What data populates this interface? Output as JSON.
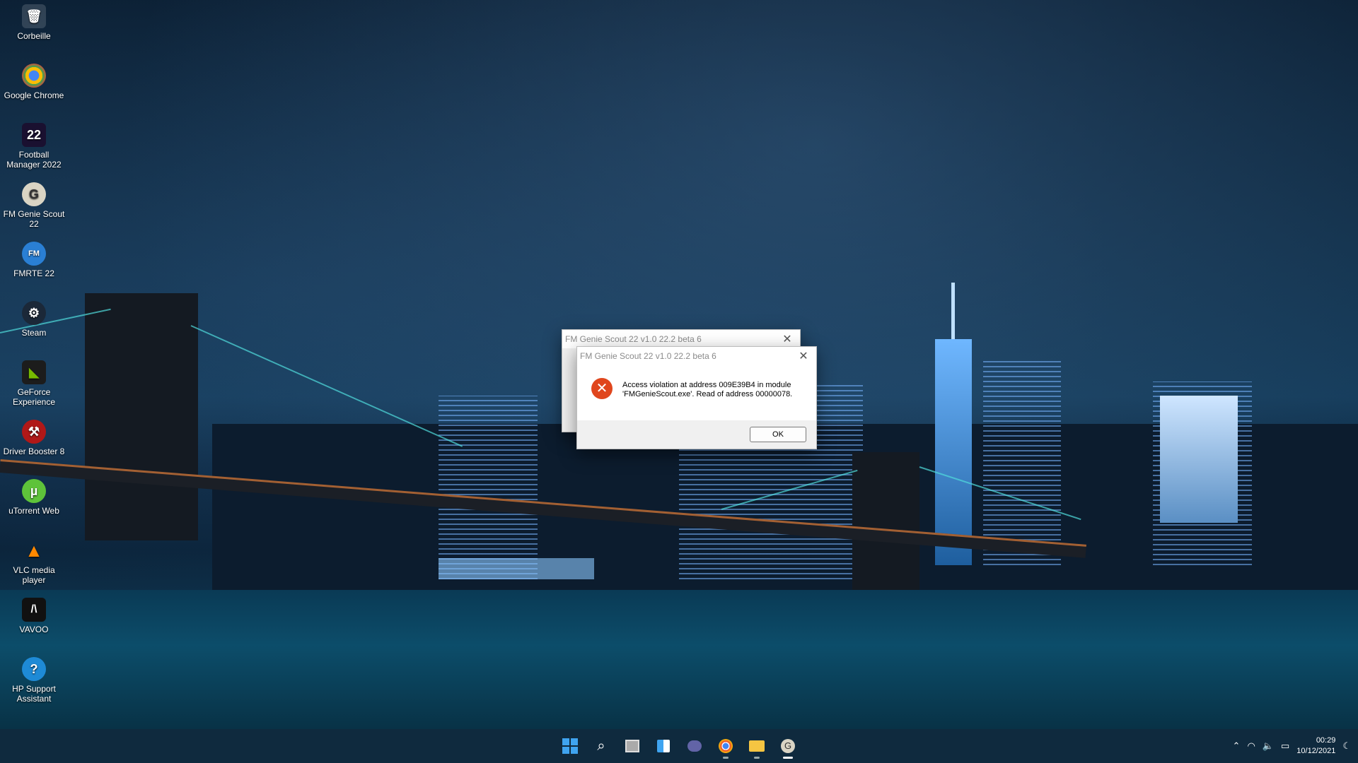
{
  "desktop": {
    "icons": [
      {
        "label": "Corbeille",
        "icon": "recycle-bin-icon"
      },
      {
        "label": "Google Chrome",
        "icon": "chrome-icon"
      },
      {
        "label": "Football Manager 2022",
        "icon": "football-manager-icon"
      },
      {
        "label": "FM Genie Scout 22",
        "icon": "genie-scout-icon"
      },
      {
        "label": "FMRTE 22",
        "icon": "fmrte-icon"
      },
      {
        "label": "Steam",
        "icon": "steam-icon"
      },
      {
        "label": "GeForce Experience",
        "icon": "geforce-icon"
      },
      {
        "label": "Driver Booster 8",
        "icon": "driver-booster-icon"
      },
      {
        "label": "uTorrent Web",
        "icon": "utorrent-icon"
      },
      {
        "label": "VLC media player",
        "icon": "vlc-icon"
      },
      {
        "label": "VAVOO",
        "icon": "vavoo-icon"
      },
      {
        "label": "HP Support Assistant",
        "icon": "hp-support-icon"
      }
    ]
  },
  "dialog_back": {
    "title": "FM Genie Scout 22 v1.0 22.2 beta 6",
    "close_glyph": "✕"
  },
  "dialog_front": {
    "title": "FM Genie Scout 22 v1.0 22.2 beta 6",
    "close_glyph": "✕",
    "message_line1": "Access violation at address 009E39B4 in module",
    "message_line2": "'FMGenieScout.exe'. Read of address 00000078.",
    "ok_label": "OK",
    "error_glyph": "✕"
  },
  "taskbar": {
    "apps": [
      "start-icon",
      "search-icon",
      "task-view-icon",
      "widgets-icon",
      "chat-icon",
      "chrome-icon",
      "file-explorer-icon",
      "genie-scout-icon"
    ],
    "tray": {
      "chevron": "⌃",
      "time": "00:29",
      "date": "10/12/2021"
    }
  },
  "colors": {
    "error_red": "#e0461d",
    "taskbar_bg": "#0f2a3e"
  }
}
